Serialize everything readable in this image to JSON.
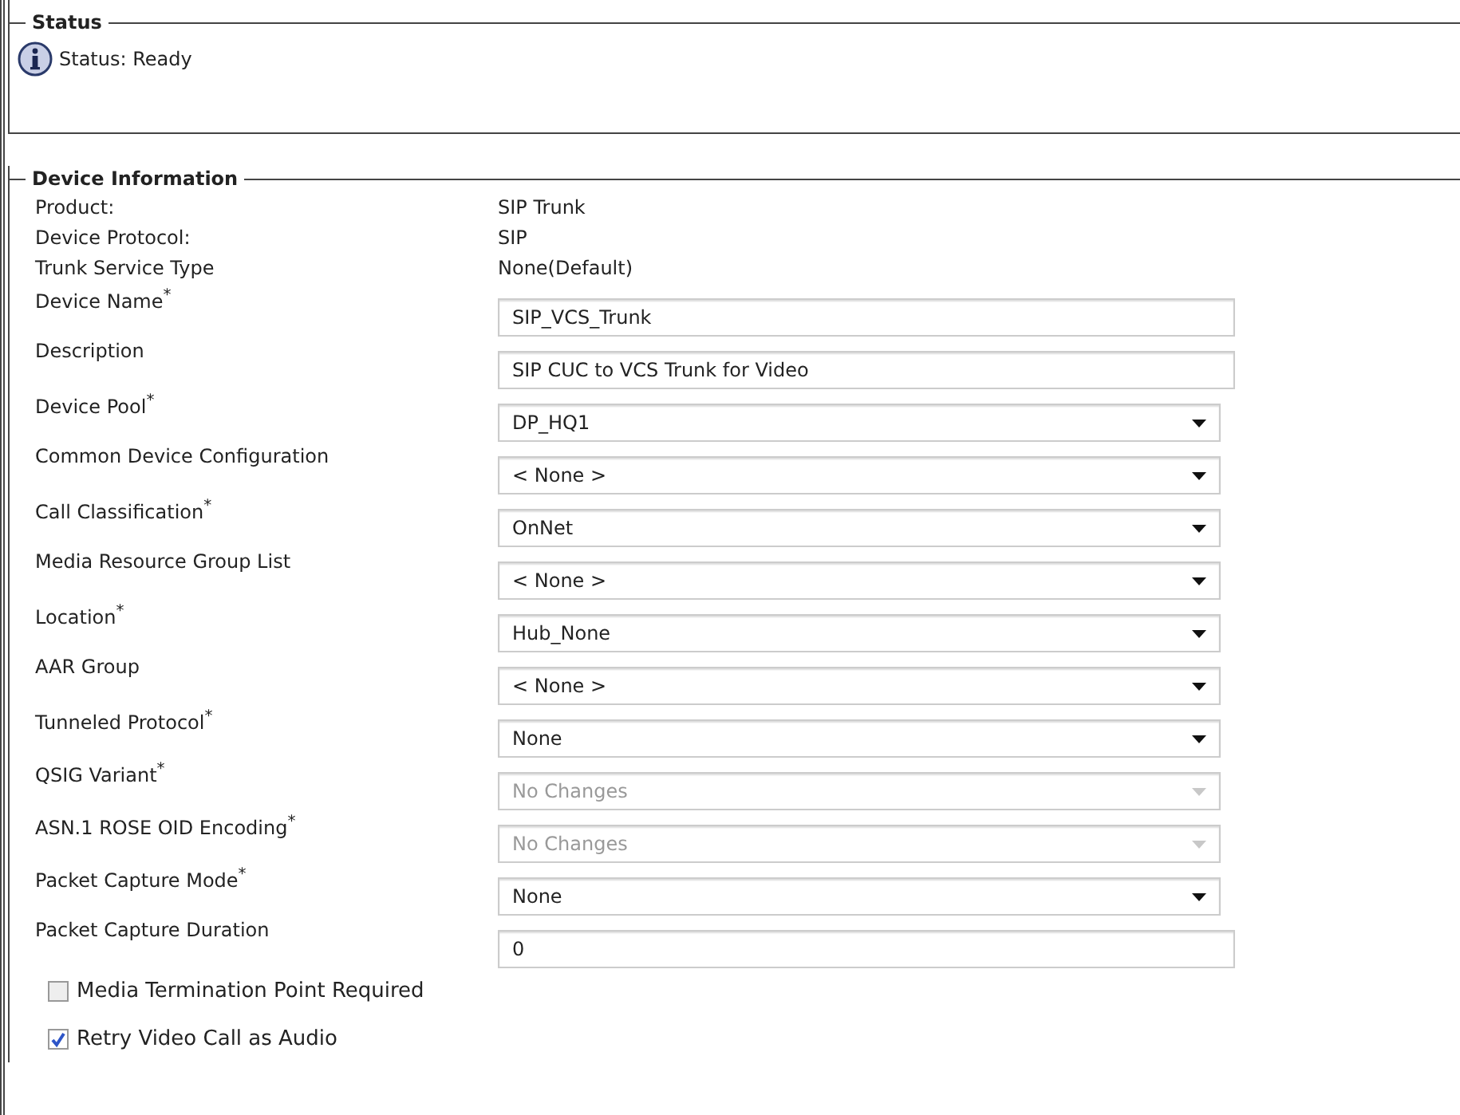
{
  "status": {
    "legend": "Status",
    "message": "Status: Ready"
  },
  "device_information": {
    "legend": "Device Information",
    "info": [
      {
        "label": "Product:",
        "value": "SIP Trunk"
      },
      {
        "label": "Device Protocol:",
        "value": "SIP"
      },
      {
        "label": "Trunk Service Type",
        "value": "None(Default)"
      }
    ],
    "fields": [
      {
        "label": "Device Name$^{*}$",
        "kind": "text",
        "value": "SIP_VCS_Trunk",
        "disabled": false
      },
      {
        "label": "Description",
        "kind": "text",
        "value": "SIP CUC to VCS Trunk for Video",
        "disabled": false
      },
      {
        "label": "Device Pool$^{*}$",
        "kind": "select",
        "value": "DP_HQ1",
        "disabled": false
      },
      {
        "label": "Common Device Configuration",
        "kind": "select",
        "value": "< None >",
        "disabled": false
      },
      {
        "label": "Call Classification$^{*}$",
        "kind": "select",
        "value": "OnNet",
        "disabled": false
      },
      {
        "label": "Media Resource Group List",
        "kind": "select",
        "value": "< None >",
        "disabled": false
      },
      {
        "label": "Location$^{*}$",
        "kind": "select",
        "value": "Hub_None",
        "disabled": false
      },
      {
        "label": "AAR Group",
        "kind": "select",
        "value": "< None >",
        "disabled": false
      },
      {
        "label": "Tunneled Protocol$^{*}$",
        "kind": "select",
        "value": "None",
        "disabled": false
      },
      {
        "label": "QSIG Variant$^{*}$",
        "kind": "select",
        "value": "No Changes",
        "disabled": true
      },
      {
        "label": "ASN.1 ROSE OID Encoding$^{*}$",
        "kind": "select",
        "value": "No Changes",
        "disabled": true
      },
      {
        "label": "Packet Capture Mode$^{*}$",
        "kind": "select",
        "value": "None",
        "disabled": false
      },
      {
        "label": "Packet Capture Duration",
        "kind": "text",
        "value": "0",
        "disabled": false
      }
    ],
    "checkboxes": [
      {
        "label": "Media Termination Point Required",
        "checked": false
      },
      {
        "label": "Retry Video Call as Audio",
        "checked": true
      }
    ]
  }
}
